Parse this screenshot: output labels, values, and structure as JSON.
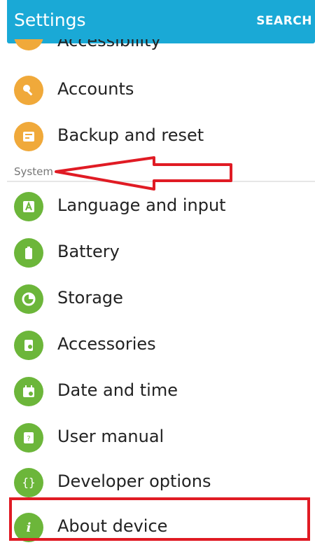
{
  "header": {
    "title": "Settings",
    "search_label": "SEARCH"
  },
  "items": [
    {
      "label": "Accessibility",
      "icon": "accessibility-icon",
      "color": "#f0a93a"
    },
    {
      "label": "Accounts",
      "icon": "key-icon",
      "color": "#f0a93a"
    },
    {
      "label": "Backup and reset",
      "icon": "backup-icon",
      "color": "#f0a93a"
    },
    {
      "label": "Language and input",
      "icon": "language-icon",
      "color": "#6cb63a"
    },
    {
      "label": "Battery",
      "icon": "battery-icon",
      "color": "#6cb63a"
    },
    {
      "label": "Storage",
      "icon": "storage-icon",
      "color": "#6cb63a"
    },
    {
      "label": "Accessories",
      "icon": "accessories-icon",
      "color": "#6cb63a"
    },
    {
      "label": "Date and time",
      "icon": "calendar-icon",
      "color": "#6cb63a"
    },
    {
      "label": "User manual",
      "icon": "manual-icon",
      "color": "#6cb63a"
    },
    {
      "label": "Developer options",
      "icon": "code-icon",
      "color": "#6cb63a"
    },
    {
      "label": "About device",
      "icon": "info-icon",
      "color": "#6cb63a"
    }
  ],
  "section": {
    "system": "System"
  },
  "annotations": {
    "arrow_color": "#e01b24",
    "highlight_color": "#e01b24"
  }
}
